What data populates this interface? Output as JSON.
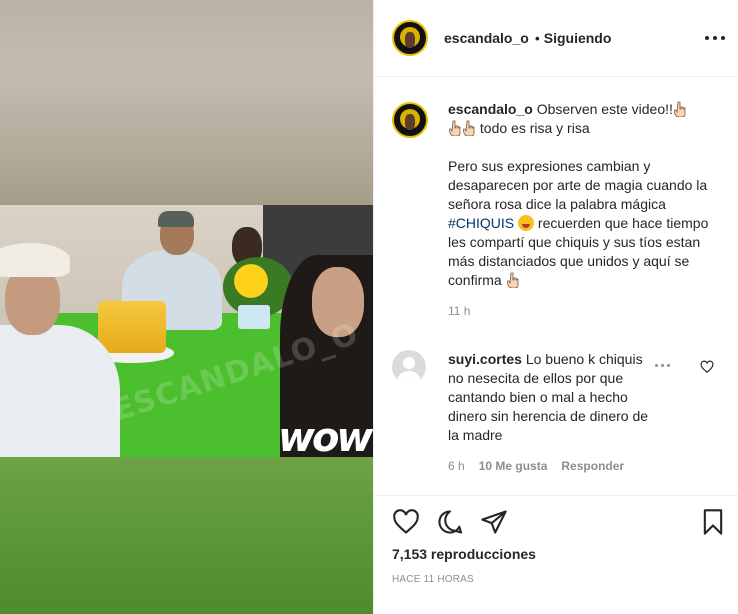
{
  "header": {
    "username": "escandalo_o",
    "separator": "•",
    "follow_status": "Siguiendo"
  },
  "media": {
    "watermark": "ESCANDALO_O",
    "sticker_text": "wow"
  },
  "caption": {
    "username": "escandalo_o",
    "line1": "Observen este video!!",
    "line2": "todo es risa y risa",
    "para2_before": "Pero sus expresiones cambian y desaparecen por arte de magia cuando la señora rosa dice la palabra mágica",
    "hashtag": "#CHIQUIS",
    "para2_after": "recuerden que hace tiempo les compartí que chiquis y sus tíos estan más distanciados que unidos y aquí se confirma",
    "time": "11 h"
  },
  "comment": {
    "username": "suyi.cortes",
    "text": "Lo bueno k chiquis no nesecita de ellos por que cantando bien o mal a hecho dinero sin herencia de dinero de la madre",
    "time": "6 h",
    "likes": "10 Me gusta",
    "reply": "Responder"
  },
  "actions": {
    "views": "7,153 reproducciones",
    "posted_ago": "HACE 11 HORAS"
  },
  "icons": [
    "more-options-icon",
    "like-heart-icon",
    "comment-icon",
    "share-icon",
    "save-bookmark-icon",
    "pointing-hand-icon",
    "grinning-emoji-icon"
  ]
}
